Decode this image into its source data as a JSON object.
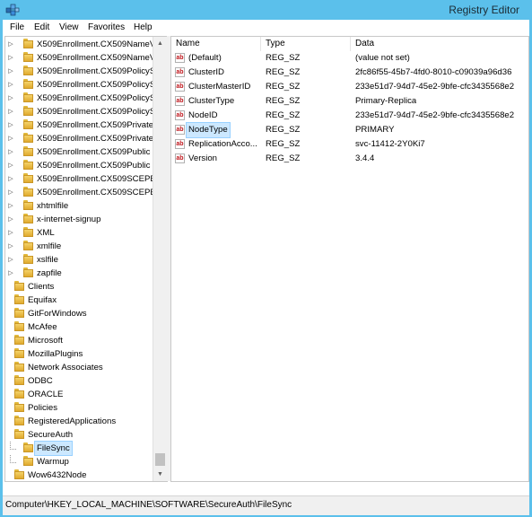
{
  "window": {
    "title": "Registry Editor"
  },
  "menu": [
    "File",
    "Edit",
    "View",
    "Favorites",
    "Help"
  ],
  "tree": {
    "nodes": [
      {
        "label": "X509Enrollment.CX509NameV",
        "level": 1,
        "expandable": true
      },
      {
        "label": "X509Enrollment.CX509NameV",
        "level": 1,
        "expandable": true
      },
      {
        "label": "X509Enrollment.CX509PolicyS",
        "level": 1,
        "expandable": true
      },
      {
        "label": "X509Enrollment.CX509PolicyS",
        "level": 1,
        "expandable": true
      },
      {
        "label": "X509Enrollment.CX509PolicyS",
        "level": 1,
        "expandable": true
      },
      {
        "label": "X509Enrollment.CX509PolicyS",
        "level": 1,
        "expandable": true
      },
      {
        "label": "X509Enrollment.CX509Private",
        "level": 1,
        "expandable": true
      },
      {
        "label": "X509Enrollment.CX509Private",
        "level": 1,
        "expandable": true
      },
      {
        "label": "X509Enrollment.CX509Public",
        "level": 1,
        "expandable": true
      },
      {
        "label": "X509Enrollment.CX509Public",
        "level": 1,
        "expandable": true
      },
      {
        "label": "X509Enrollment.CX509SCEPE",
        "level": 1,
        "expandable": true
      },
      {
        "label": "X509Enrollment.CX509SCEPE",
        "level": 1,
        "expandable": true
      },
      {
        "label": "xhtmlfile",
        "level": 1,
        "expandable": true
      },
      {
        "label": "x-internet-signup",
        "level": 1,
        "expandable": true
      },
      {
        "label": "XML",
        "level": 1,
        "expandable": true
      },
      {
        "label": "xmlfile",
        "level": 1,
        "expandable": true
      },
      {
        "label": "xslfile",
        "level": 1,
        "expandable": true
      },
      {
        "label": "zapfile",
        "level": 1,
        "expandable": true
      },
      {
        "label": "Clients",
        "level": 0,
        "expandable": true
      },
      {
        "label": "Equifax",
        "level": 0,
        "expandable": true
      },
      {
        "label": "GitForWindows",
        "level": 0,
        "expandable": true
      },
      {
        "label": "McAfee",
        "level": 0,
        "expandable": true
      },
      {
        "label": "Microsoft",
        "level": 0,
        "expandable": true
      },
      {
        "label": "MozillaPlugins",
        "level": 0,
        "expandable": true
      },
      {
        "label": "Network Associates",
        "level": 0,
        "expandable": true
      },
      {
        "label": "ODBC",
        "level": 0,
        "expandable": true
      },
      {
        "label": "ORACLE",
        "level": 0,
        "expandable": true
      },
      {
        "label": "Policies",
        "level": 0,
        "expandable": true
      },
      {
        "label": "RegisteredApplications",
        "level": 0,
        "expandable": false
      },
      {
        "label": "SecureAuth",
        "level": 0,
        "expandable": true,
        "expanded": true
      },
      {
        "label": "FileSync",
        "level": 1,
        "expandable": false,
        "selected": true
      },
      {
        "label": "Warmup",
        "level": 1,
        "expandable": false
      },
      {
        "label": "Wow6432Node",
        "level": 0,
        "expandable": true
      }
    ]
  },
  "values": {
    "columns": {
      "name": "Name",
      "type": "Type",
      "data": "Data"
    },
    "rows": [
      {
        "name": "(Default)",
        "type": "REG_SZ",
        "data": "(value not set)"
      },
      {
        "name": "ClusterID",
        "type": "REG_SZ",
        "data": "2fc86f55-45b7-4fd0-8010-c09039a96d36"
      },
      {
        "name": "ClusterMasterID",
        "type": "REG_SZ",
        "data": "233e51d7-94d7-45e2-9bfe-cfc3435568e2"
      },
      {
        "name": "ClusterType",
        "type": "REG_SZ",
        "data": "Primary-Replica"
      },
      {
        "name": "NodeID",
        "type": "REG_SZ",
        "data": "233e51d7-94d7-45e2-9bfe-cfc3435568e2"
      },
      {
        "name": "NodeType",
        "type": "REG_SZ",
        "data": "PRIMARY",
        "selected": true
      },
      {
        "name": "ReplicationAcco...",
        "type": "REG_SZ",
        "data": "svc-11412-2Y0Ki7"
      },
      {
        "name": "Version",
        "type": "REG_SZ",
        "data": "3.4.4"
      }
    ]
  },
  "status": {
    "path": "Computer\\HKEY_LOCAL_MACHINE\\SOFTWARE\\SecureAuth\\FileSync"
  },
  "colors": {
    "title_bar": "#5bc0eb",
    "selection": "#cce8ff",
    "ab_icon": "#c0151b"
  }
}
